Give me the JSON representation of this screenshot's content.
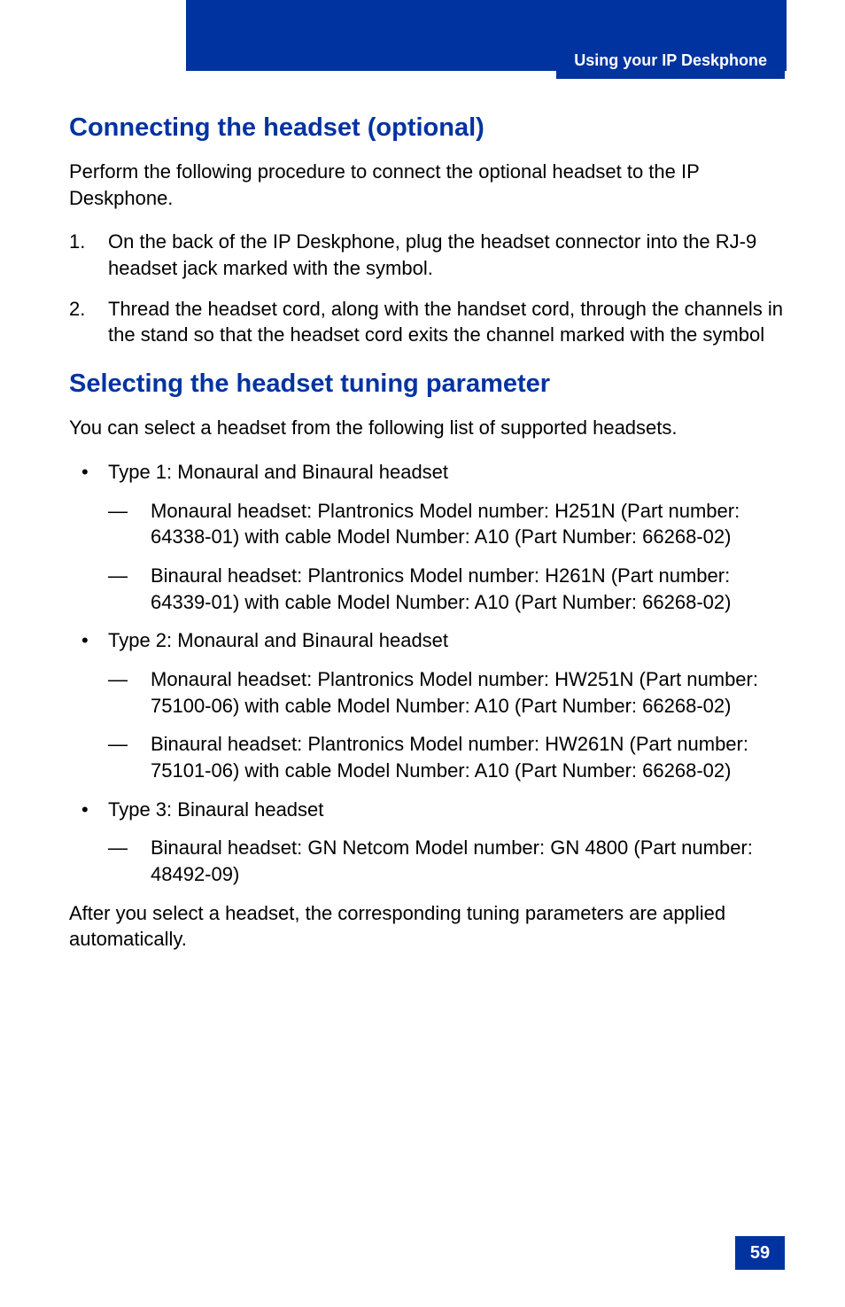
{
  "header": {
    "running_title": "Using your IP Deskphone"
  },
  "section1": {
    "title": "Connecting the headset (optional)",
    "intro": "Perform the following procedure to connect the optional headset to the IP Deskphone.",
    "steps": [
      "On the back of the IP Deskphone, plug the headset connector into the RJ-9 headset jack marked with the   symbol.",
      "Thread the headset cord, along with the handset cord, through the channels in the stand so that the headset cord exits the channel marked with the   symbol"
    ]
  },
  "section2": {
    "title": "Selecting the headset tuning parameter",
    "intro": "You can select a headset from the following list of supported headsets.",
    "types": [
      {
        "label": "Type 1: Monaural and Binaural headset",
        "items": [
          " Monaural headset: Plantronics Model number: H251N (Part number: 64338-01) with cable Model Number: A10 (Part Number: 66268-02)",
          " Binaural headset: Plantronics Model number: H261N (Part number: 64339-01) with cable Model Number: A10 (Part Number: 66268-02)"
        ]
      },
      {
        "label": "Type 2: Monaural and Binaural headset",
        "items": [
          "Monaural headset: Plantronics Model number: HW251N (Part number: 75100-06) with cable Model Number: A10 (Part Number: 66268-02)",
          "Binaural headset: Plantronics Model number: HW261N (Part number: 75101-06) with cable Model Number: A10 (Part Number: 66268-02)"
        ]
      },
      {
        "label": "Type 3: Binaural headset",
        "items": [
          "Binaural headset: GN Netcom Model number: GN 4800 (Part number: 48492-09)"
        ]
      }
    ],
    "outro": " After you select a headset, the corresponding tuning parameters are applied automatically."
  },
  "page_number": "59"
}
